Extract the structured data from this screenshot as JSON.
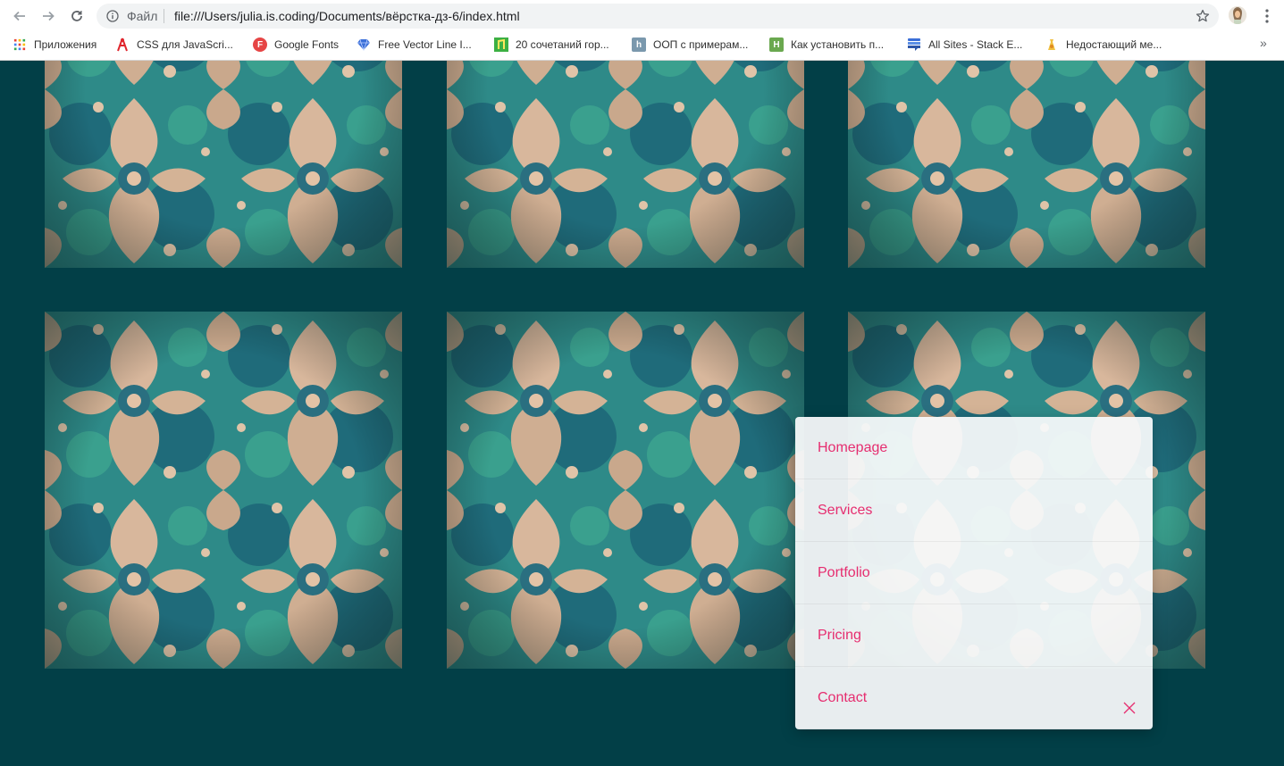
{
  "browser": {
    "scheme_label": "Файл",
    "url": "file:///Users/julia.is.coding/Documents/вёрстка-дз-6/index.html",
    "bookmarks": [
      {
        "label": "Приложения",
        "icon": "apps-grid-icon"
      },
      {
        "label": "CSS для JavaScri...",
        "icon": "css-bookmark-icon"
      },
      {
        "label": "Google Fonts",
        "icon": "google-fonts-icon"
      },
      {
        "label": "Free Vector Line I...",
        "icon": "diamond-icon"
      },
      {
        "label": "20 сочетаний гор...",
        "icon": "green-bookmark-icon"
      },
      {
        "label": "ООП с примерам...",
        "icon": "habr-icon"
      },
      {
        "label": "Как установить п...",
        "icon": "green-h-icon"
      },
      {
        "label": "All Sites - Stack E...",
        "icon": "stackexchange-icon"
      },
      {
        "label": "Недостающий ме...",
        "icon": "bookmark-icon"
      }
    ]
  },
  "colors": {
    "page_bg": "#023f47",
    "menu_text": "#e62d6f",
    "menu_bg": "#f7f9fa"
  },
  "gallery": {
    "image_count": 6,
    "image_icon": "damask-pattern-image"
  },
  "menu": {
    "items": [
      {
        "label": "Homepage"
      },
      {
        "label": "Services"
      },
      {
        "label": "Portfolio"
      },
      {
        "label": "Pricing"
      },
      {
        "label": "Contact"
      }
    ],
    "close_icon": "close-icon"
  }
}
